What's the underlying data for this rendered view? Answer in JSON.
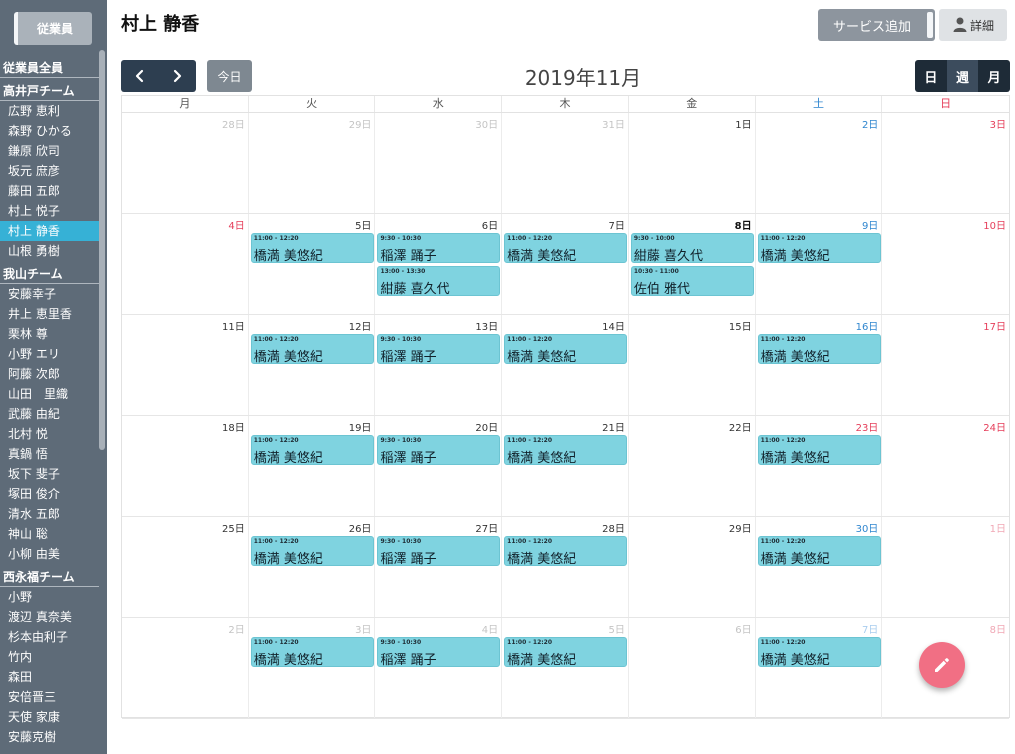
{
  "sidebar": {
    "employee_button": "従業員",
    "groups": [
      {
        "label": "従業員全員",
        "members": []
      },
      {
        "label": "高井戸チーム",
        "members": [
          "広野 恵利",
          "森野 ひかる",
          "鎌原 欣司",
          "坂元 庶彦",
          "藤田 五郎",
          "村上 悦子",
          "村上 静香",
          "山根 勇樹"
        ]
      },
      {
        "label": "我山チーム",
        "members": [
          "安藤幸子",
          "井上 恵里香",
          "栗林 尊",
          "小野 エリ",
          "阿藤 次郎",
          "山田　里織",
          "武藤 由紀",
          "北村 悦",
          "真鍋 悟",
          "坂下 斐子",
          "塚田 俊介",
          "清水 五郎",
          "神山 聡",
          "小柳 由美"
        ]
      },
      {
        "label": "西永福チーム",
        "members": [
          "小野",
          "渡辺 真奈美",
          "杉本由利子",
          "竹内",
          "森田",
          "安倍晋三",
          "天使 家康",
          "安藤克樹"
        ]
      }
    ],
    "active_member": "村上 静香"
  },
  "header": {
    "title": "村上 静香",
    "add_service_label": "サービス追加",
    "detail_label": "詳細"
  },
  "toolbar": {
    "today_label": "今日",
    "month_title": "2019年11月",
    "views": [
      "日",
      "週",
      "月"
    ],
    "active_view": "週"
  },
  "calendar": {
    "weekdays": [
      "月",
      "火",
      "水",
      "木",
      "金",
      "土",
      "日"
    ],
    "weeks": [
      [
        {
          "label": "28日",
          "other": true,
          "events": []
        },
        {
          "label": "29日",
          "other": true,
          "events": []
        },
        {
          "label": "30日",
          "other": true,
          "events": []
        },
        {
          "label": "31日",
          "other": true,
          "events": []
        },
        {
          "label": "1日",
          "events": []
        },
        {
          "label": "2日",
          "events": []
        },
        {
          "label": "3日",
          "events": []
        }
      ],
      [
        {
          "label": "4日",
          "holiday": true,
          "events": []
        },
        {
          "label": "5日",
          "events": [
            {
              "time": "11:00 - 12:20",
              "name": "橋満 美悠紀"
            }
          ]
        },
        {
          "label": "6日",
          "events": [
            {
              "time": "9:30 - 10:30",
              "name": "稲澤 踊子"
            },
            {
              "time": "13:00 - 13:30",
              "name": "紺藤 喜久代"
            }
          ]
        },
        {
          "label": "7日",
          "events": [
            {
              "time": "11:00 - 12:20",
              "name": "橋満 美悠紀"
            }
          ]
        },
        {
          "label": "8日",
          "today": true,
          "events": [
            {
              "time": "9:30 - 10:00",
              "name": "紺藤 喜久代"
            },
            {
              "time": "10:30 - 11:00",
              "name": "佐伯 雅代"
            }
          ]
        },
        {
          "label": "9日",
          "events": [
            {
              "time": "11:00 - 12:20",
              "name": "橋満 美悠紀"
            }
          ]
        },
        {
          "label": "10日",
          "events": []
        }
      ],
      [
        {
          "label": "11日",
          "events": []
        },
        {
          "label": "12日",
          "events": [
            {
              "time": "11:00 - 12:20",
              "name": "橋満 美悠紀"
            }
          ]
        },
        {
          "label": "13日",
          "events": [
            {
              "time": "9:30 - 10:30",
              "name": "稲澤 踊子"
            }
          ]
        },
        {
          "label": "14日",
          "events": [
            {
              "time": "11:00 - 12:20",
              "name": "橋満 美悠紀"
            }
          ]
        },
        {
          "label": "15日",
          "events": []
        },
        {
          "label": "16日",
          "events": [
            {
              "time": "11:00 - 12:20",
              "name": "橋満 美悠紀"
            }
          ]
        },
        {
          "label": "17日",
          "events": []
        }
      ],
      [
        {
          "label": "18日",
          "events": []
        },
        {
          "label": "19日",
          "events": [
            {
              "time": "11:00 - 12:20",
              "name": "橋満 美悠紀"
            }
          ]
        },
        {
          "label": "20日",
          "events": [
            {
              "time": "9:30 - 10:30",
              "name": "稲澤 踊子"
            }
          ]
        },
        {
          "label": "21日",
          "events": [
            {
              "time": "11:00 - 12:20",
              "name": "橋満 美悠紀"
            }
          ]
        },
        {
          "label": "22日",
          "events": []
        },
        {
          "label": "23日",
          "holiday": true,
          "events": [
            {
              "time": "11:00 - 12:20",
              "name": "橋満 美悠紀"
            }
          ]
        },
        {
          "label": "24日",
          "events": []
        }
      ],
      [
        {
          "label": "25日",
          "events": []
        },
        {
          "label": "26日",
          "events": [
            {
              "time": "11:00 - 12:20",
              "name": "橋満 美悠紀"
            }
          ]
        },
        {
          "label": "27日",
          "events": [
            {
              "time": "9:30 - 10:30",
              "name": "稲澤 踊子"
            }
          ]
        },
        {
          "label": "28日",
          "events": [
            {
              "time": "11:00 - 12:20",
              "name": "橋満 美悠紀"
            }
          ]
        },
        {
          "label": "29日",
          "events": []
        },
        {
          "label": "30日",
          "events": [
            {
              "time": "11:00 - 12:20",
              "name": "橋満 美悠紀"
            }
          ]
        },
        {
          "label": "1日",
          "other": true,
          "events": []
        }
      ],
      [
        {
          "label": "2日",
          "other": true,
          "events": []
        },
        {
          "label": "3日",
          "other": true,
          "events": [
            {
              "time": "11:00 - 12:20",
              "name": "橋満 美悠紀"
            }
          ]
        },
        {
          "label": "4日",
          "other": true,
          "events": [
            {
              "time": "9:30 - 10:30",
              "name": "稲澤 踊子"
            }
          ]
        },
        {
          "label": "5日",
          "other": true,
          "events": [
            {
              "time": "11:00 - 12:20",
              "name": "橋満 美悠紀"
            }
          ]
        },
        {
          "label": "6日",
          "other": true,
          "events": []
        },
        {
          "label": "7日",
          "other": true,
          "events": [
            {
              "time": "11:00 - 12:20",
              "name": "橋満 美悠紀"
            }
          ]
        },
        {
          "label": "8日",
          "other": true,
          "events": []
        }
      ]
    ]
  },
  "icons": {
    "prev": "chevron-left-icon",
    "next": "chevron-right-icon",
    "detail": "user-icon",
    "fab": "pencil-icon"
  },
  "colors": {
    "sidebar_bg": "#5e6b78",
    "active_member": "#36b1d6",
    "event": "#7fd3e0",
    "saturday": "#2f86cf",
    "sunday": "#e53e5a",
    "fab": "#f16f84",
    "nav_dark": "#2d3e50"
  }
}
